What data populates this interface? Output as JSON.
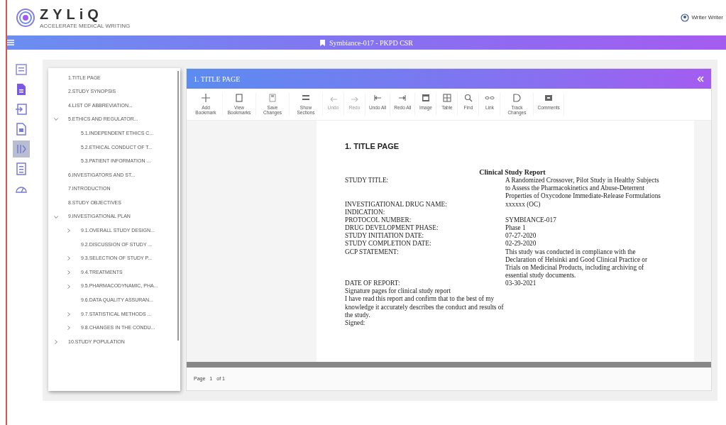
{
  "header": {
    "logo": "ZYLiQ",
    "tagline": "ACCELERATE MEDICAL WRITING",
    "user": "Writer Writer"
  },
  "title_bar": {
    "title": "Symbiance-017 - PKPD CSR"
  },
  "rail": [
    {
      "selected": false
    },
    {
      "selected": false
    },
    {
      "selected": false
    },
    {
      "selected": false
    },
    {
      "selected": true
    },
    {
      "selected": false
    },
    {
      "selected": false
    }
  ],
  "toc": [
    {
      "label": "1.TITLE PAGE",
      "kind": "leaf"
    },
    {
      "label": "2.STUDY SYNOPSIS",
      "kind": "leaf"
    },
    {
      "label": "4.LIST OF ABBREVIATION...",
      "kind": "leaf"
    },
    {
      "label": "5.ETHICS AND REGULATOR...",
      "kind": "folder",
      "expanded": true,
      "children": [
        {
          "label": "5.1.INDEPENDENT ETHICS C...",
          "kind": "leaf"
        },
        {
          "label": "5.2.ETHICAL CONDUCT OF T...",
          "kind": "leaf"
        },
        {
          "label": "5.3.PATIENT INFORMATION ...",
          "kind": "leaf"
        }
      ]
    },
    {
      "label": "6.INVESTIGATORS AND ST...",
      "kind": "leaf"
    },
    {
      "label": "7.INTRODUCTION",
      "kind": "leaf"
    },
    {
      "label": "8.STUDY OBJECTIVES",
      "kind": "leaf"
    },
    {
      "label": "9.INVESTIGATIONAL PLAN",
      "kind": "folder",
      "expanded": true,
      "children": [
        {
          "label": "9.1.OVERALL STUDY DESIGN...",
          "kind": "folder",
          "expanded": false
        },
        {
          "label": "9.2.DISCUSSION OF STUDY ...",
          "kind": "leaf"
        },
        {
          "label": "9.3.SELECTION OF STUDY P...",
          "kind": "folder",
          "expanded": false
        },
        {
          "label": "9.4.TREATMENTS",
          "kind": "folder",
          "expanded": false
        },
        {
          "label": "9.5.PHARMACODYNAMIC, PHA...",
          "kind": "folder",
          "expanded": false
        },
        {
          "label": "9.6.DATA QUALITY ASSURAN...",
          "kind": "leaf"
        },
        {
          "label": "9.7.STATISTICAL METHODS ...",
          "kind": "folder",
          "expanded": false
        },
        {
          "label": "9.8.CHANGES IN THE CONDU...",
          "kind": "folder",
          "expanded": false
        }
      ]
    },
    {
      "label": "10.STUDY POPULATION",
      "kind": "folder",
      "expanded": false
    }
  ],
  "editor": {
    "title": "1. TITLE PAGE",
    "toolbar": [
      {
        "label": "Add Bookmark",
        "disabled": false
      },
      {
        "label": "View Bookmarks",
        "disabled": false
      },
      {
        "label": "Save Changes",
        "disabled": false
      },
      {
        "label": "Show Sections",
        "disabled": false
      },
      {
        "label": "Undo",
        "disabled": true
      },
      {
        "label": "Redo",
        "disabled": true
      },
      {
        "label": "Undo All",
        "disabled": false
      },
      {
        "label": "Redo All",
        "disabled": false
      },
      {
        "label": "Image",
        "disabled": false
      },
      {
        "label": "Table",
        "disabled": false
      },
      {
        "label": "Find",
        "disabled": false
      },
      {
        "label": "Link",
        "disabled": false
      },
      {
        "label": "Track Changes",
        "disabled": false
      },
      {
        "label": "Comments",
        "disabled": false
      }
    ],
    "document": {
      "heading": "1. TITLE PAGE",
      "report_title": "Clinical Study Report",
      "fields": [
        {
          "label": "STUDY TITLE:",
          "value": "A Randomized Crossover, Pilot Study in Healthy Subjects to Assess the Pharmacokinetics and Abuse-Deterrent Properties of Oxycodone Immediate-Release Formulations"
        },
        {
          "label": "INVESTIGATIONAL DRUG NAME:",
          "value": "xxxxxx (OC)"
        },
        {
          "label": "INDICATION:"
        },
        {
          "label": "PROTOCOL NUMBER:",
          "value": "SYMBIANCE-017"
        },
        {
          "label": "DRUG DEVELOPMENT PHASE:",
          "value": "Phase 1"
        },
        {
          "label": "STUDY INITIATION DATE:",
          "value": "07-27-2020"
        },
        {
          "label": "STUDY COMPLETION DATE:",
          "value": "02-29-2020"
        },
        {
          "label": "GCP STATEMENT:",
          "value": "This study was conducted in compliance with the Declaration of Helsinki and Good Clinical Practice or Trials on Medicinal Products, including archiving of essential study documents."
        },
        {
          "label": "DATE OF REPORT:",
          "value": "03-30-2021"
        }
      ],
      "paragraphs": [
        "Signature pages for clinical study report",
        "I have read this report and confirm that to the best of my knowledge it accurately describes the conduct and results of the study.",
        "Signed:"
      ]
    },
    "footer": {
      "page_label": "Page",
      "page": "1",
      "of": "of 1"
    }
  }
}
